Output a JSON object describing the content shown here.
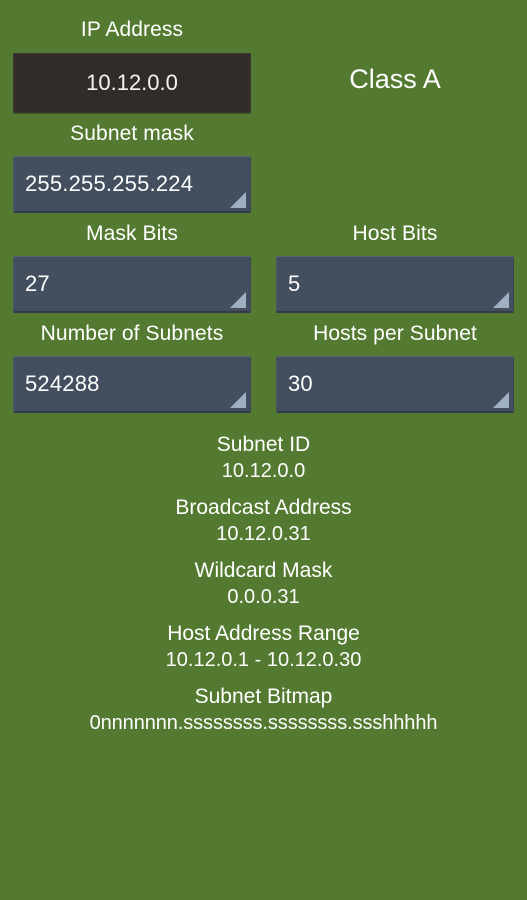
{
  "theme": {
    "background": "#547A31",
    "ip_field_bg": "#302D28",
    "spinner_bg": "#434E5E",
    "spinner_caret": "#9FB0C2",
    "text": "#FFFFFF"
  },
  "form": {
    "ip_address": {
      "label": "IP Address",
      "value": "10.12.0.0",
      "placeholder": "10.12.0.0"
    },
    "ip_class": {
      "value": "Class A"
    },
    "subnet_mask": {
      "label": "Subnet mask",
      "value": "255.255.255.224"
    },
    "mask_bits": {
      "label": "Mask Bits",
      "value": "27"
    },
    "host_bits": {
      "label": "Host Bits",
      "value": "5"
    },
    "number_of_subnets": {
      "label": "Number of Subnets",
      "value": "524288"
    },
    "hosts_per_subnet": {
      "label": "Hosts per Subnet",
      "value": "30"
    }
  },
  "results": [
    {
      "name": "Subnet ID",
      "value": "10.12.0.0"
    },
    {
      "name": "Broadcast Address",
      "value": "10.12.0.31"
    },
    {
      "name": "Wildcard Mask",
      "value": "0.0.0.31"
    },
    {
      "name": "Host Address Range",
      "value": "10.12.0.1 - 10.12.0.30"
    },
    {
      "name": "Subnet Bitmap",
      "value": "0nnnnnnn.ssssssss.ssssssss.ssshhhhh"
    }
  ],
  "icons": {
    "spinner_caret": "dropdown-triangle-icon"
  }
}
